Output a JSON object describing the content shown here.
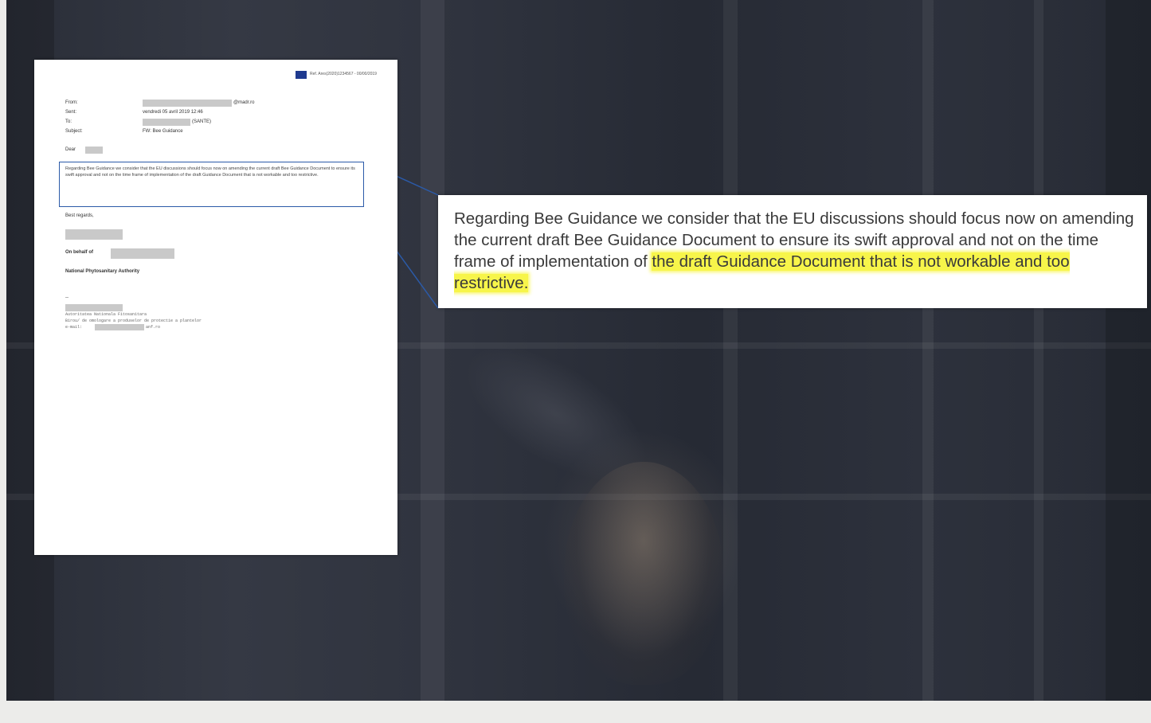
{
  "document": {
    "eu_ref": "Ref. Ares(2020)1234567 - 00/00/2019",
    "headers": [
      {
        "label": "From:",
        "value": "@madr.ro"
      },
      {
        "label": "Sent:",
        "value": "vendredi 05 avril 2019 12:46"
      },
      {
        "label": "To:",
        "value": "(SANTE)"
      },
      {
        "label": "Subject:",
        "value": "FW: Bee Guidance"
      }
    ],
    "greeting": "Dear",
    "excerpt": "Regarding Bee Guidance we consider that the EU discussions should focus now on amending the current draft Bee Guidance Document to ensure its swift approval and not on the time frame of implementation of the draft Guidance Document that is not workable and too restrictive.",
    "closing": "Best regards,",
    "on_behalf": "On behalf of",
    "authority": "National Phytosanitary Authority",
    "dash": "--",
    "signature_lines": [
      "Autoritatea Nationala Fitosanitara",
      "Birou/ de omologare a produselor de protectie a plantelor",
      "e-mail:"
    ],
    "signature_email_suffix": "anf.ro"
  },
  "callout": {
    "text_plain": "Regarding Bee Guidance we consider that the EU discussions should focus now on amending the current draft Bee Guidance Document to ensure its swift approval and not on the time frame of implementation of ",
    "text_highlighted": "the draft Guidance Document that is not workable and too restrictive."
  },
  "colors": {
    "highlight": "#f7f54a",
    "connector": "#2b5aa8",
    "background": "#2d313c"
  }
}
